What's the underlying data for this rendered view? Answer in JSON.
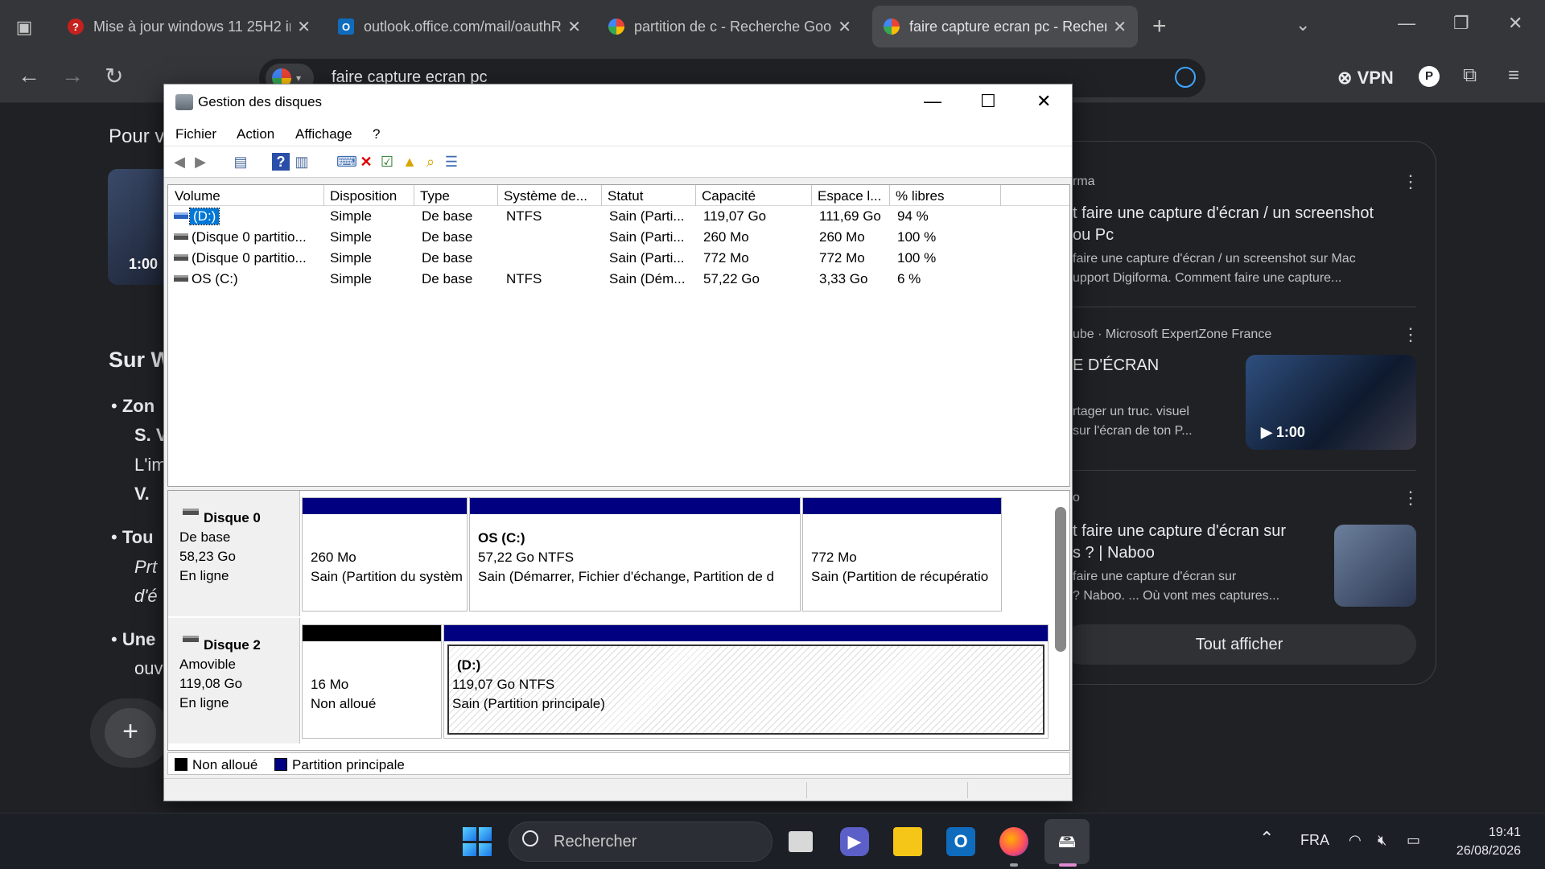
{
  "browser": {
    "tabs": [
      {
        "title": "Mise à jour windows 11 25H2 in",
        "favicon": "?",
        "favicon_color": "#c5221f",
        "active": false
      },
      {
        "title": "outlook.office.com/mail/oauthR",
        "favicon": "O",
        "favicon_color": "#0f6cbd",
        "active": false
      },
      {
        "title": "partition de c - Recherche Goog",
        "favicon": "G",
        "favicon_color": "#ffffff",
        "active": false
      },
      {
        "title": "faire capture ecran pc - Recherc",
        "favicon": "G",
        "favicon_color": "#ffffff",
        "active": true
      }
    ],
    "new_tab": "+",
    "omnibox_text": "faire capture ecran pc",
    "vpn_label": "VPN",
    "profile_initial": "P"
  },
  "page": {
    "intro": "Pour v",
    "video_duration": "1:00",
    "section_heading": "Sur W",
    "bullets": [
      {
        "line1": "Zon",
        "line2": "S. V",
        "line3": "L'im",
        "line4": "V. "
      },
      {
        "line1": "Tou",
        "line2": "Prt",
        "line3": "d'é"
      },
      {
        "line1": "Une",
        "line2": "ouv"
      }
    ],
    "add_button": "+"
  },
  "results": [
    {
      "source": "rma",
      "title_l1": "t faire une capture d'écran / un screenshot",
      "title_l2": "ou Pc",
      "snippet_l1": "faire une capture d'écran / un screenshot sur Mac",
      "snippet_l2": "upport Digiforma. Comment faire une capture..."
    },
    {
      "source": "ube · Microsoft ExpertZone France",
      "title_l1": "E D'ÉCRAN",
      "snippet_l1": "rtager un truc. visuel",
      "snippet_l2": " sur l'écran de ton P...",
      "duration": "▶ 1:00"
    },
    {
      "source": "o",
      "title_l1": "t faire une capture d'écran sur",
      "title_l2": "s ? | Naboo",
      "snippet_l1": "faire une capture d'écran sur",
      "snippet_l2": "? Naboo. ... Où vont mes captures..."
    }
  ],
  "show_all": "Tout afficher",
  "disk_mgmt": {
    "title": "Gestion des disques",
    "menu": [
      "Fichier",
      "Action",
      "Affichage",
      "?"
    ],
    "columns": [
      "Volume",
      "Disposition",
      "Type",
      "Système de...",
      "Statut",
      "Capacité",
      "Espace l...",
      "% libres"
    ],
    "volumes": [
      {
        "name": "(D:)",
        "layout": "Simple",
        "type": "De base",
        "fs": "NTFS",
        "status": "Sain (Parti...",
        "capacity": "119,07 Go",
        "free": "111,69 Go",
        "pct": "94 %"
      },
      {
        "name": "(Disque 0 partitio...",
        "layout": "Simple",
        "type": "De base",
        "fs": "",
        "status": "Sain (Parti...",
        "capacity": "260 Mo",
        "free": "260 Mo",
        "pct": "100 %"
      },
      {
        "name": "(Disque 0 partitio...",
        "layout": "Simple",
        "type": "De base",
        "fs": "",
        "status": "Sain (Parti...",
        "capacity": "772 Mo",
        "free": "772 Mo",
        "pct": "100 %"
      },
      {
        "name": "OS (C:)",
        "layout": "Simple",
        "type": "De base",
        "fs": "NTFS",
        "status": "Sain (Dém...",
        "capacity": "57,22 Go",
        "free": "3,33 Go",
        "pct": "6 %"
      }
    ],
    "disks": [
      {
        "name": "Disque 0",
        "kind": "De base",
        "size": "58,23 Go",
        "state": "En ligne",
        "partitions": [
          {
            "label": "",
            "size": "260 Mo",
            "status": "Sain (Partition du systèm"
          },
          {
            "label": "OS  (C:)",
            "size": "57,22 Go NTFS",
            "status": "Sain (Démarrer, Fichier d'échange, Partition de d"
          },
          {
            "label": "",
            "size": "772 Mo",
            "status": "Sain (Partition de récupératio"
          }
        ]
      },
      {
        "name": "Disque 2",
        "kind": "Amovible",
        "size": "119,08 Go",
        "state": "En ligne",
        "partitions": [
          {
            "label": "",
            "size": "16 Mo",
            "status": "Non alloué"
          },
          {
            "label": "(D:)",
            "size": "119,07 Go NTFS",
            "status": "Sain (Partition principale)"
          }
        ]
      }
    ],
    "legend": [
      "Non alloué",
      "Partition principale"
    ],
    "legend_colors": [
      "#000000",
      "#000080"
    ]
  },
  "taskbar": {
    "search_placeholder": "Rechercher",
    "language": "FRA",
    "time": "19:41",
    "date": "26/08/2026"
  }
}
